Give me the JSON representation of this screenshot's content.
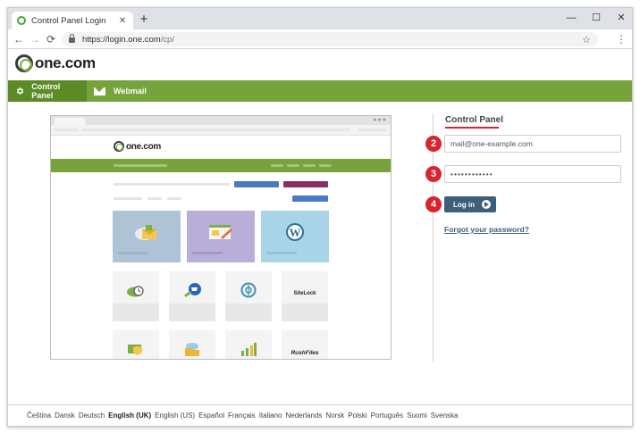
{
  "browser": {
    "tab_title": "Control Panel Login",
    "tab_close": "✕",
    "new_tab": "+",
    "url_host": "https://login.one.com",
    "url_path": "/cp/",
    "window_controls": [
      "—",
      "☐",
      "✕"
    ],
    "nav": {
      "back": "←",
      "forward": "→",
      "reload": "⟳"
    },
    "bookmark_icon": "☆",
    "menu_icon": "⋮"
  },
  "header": {
    "logo_text": "one.com",
    "nav": [
      {
        "label": "Control Panel",
        "icon": "gear-icon",
        "active": true
      },
      {
        "label": "Webmail",
        "icon": "envelope-icon",
        "active": false
      }
    ]
  },
  "preview": {
    "logo_text": "one.com",
    "tile_labels": {
      "sitelock": "SiteLock",
      "rushfiles": "RushFiles"
    }
  },
  "login": {
    "title": "Control Panel",
    "email_value": "mail@one-example.com",
    "password_value": "••••••••••••",
    "button_label": "Log in",
    "forgot_link": "Forgot your password?",
    "steps": [
      "2",
      "3",
      "4"
    ],
    "accent_color": "#d9232f",
    "button_color": "#3d5f7a"
  },
  "footer": {
    "languages": [
      "Čeština",
      "Dansk",
      "Deutsch",
      "English (UK)",
      "English (US)",
      "Español",
      "Français",
      "Italiano",
      "Nederlands",
      "Norsk",
      "Polski",
      "Português",
      "Suomi",
      "Svenska"
    ],
    "current_language": "English (UK)"
  },
  "colors": {
    "brand_green": "#76a33a",
    "brand_green_dark": "#5c8a26"
  }
}
